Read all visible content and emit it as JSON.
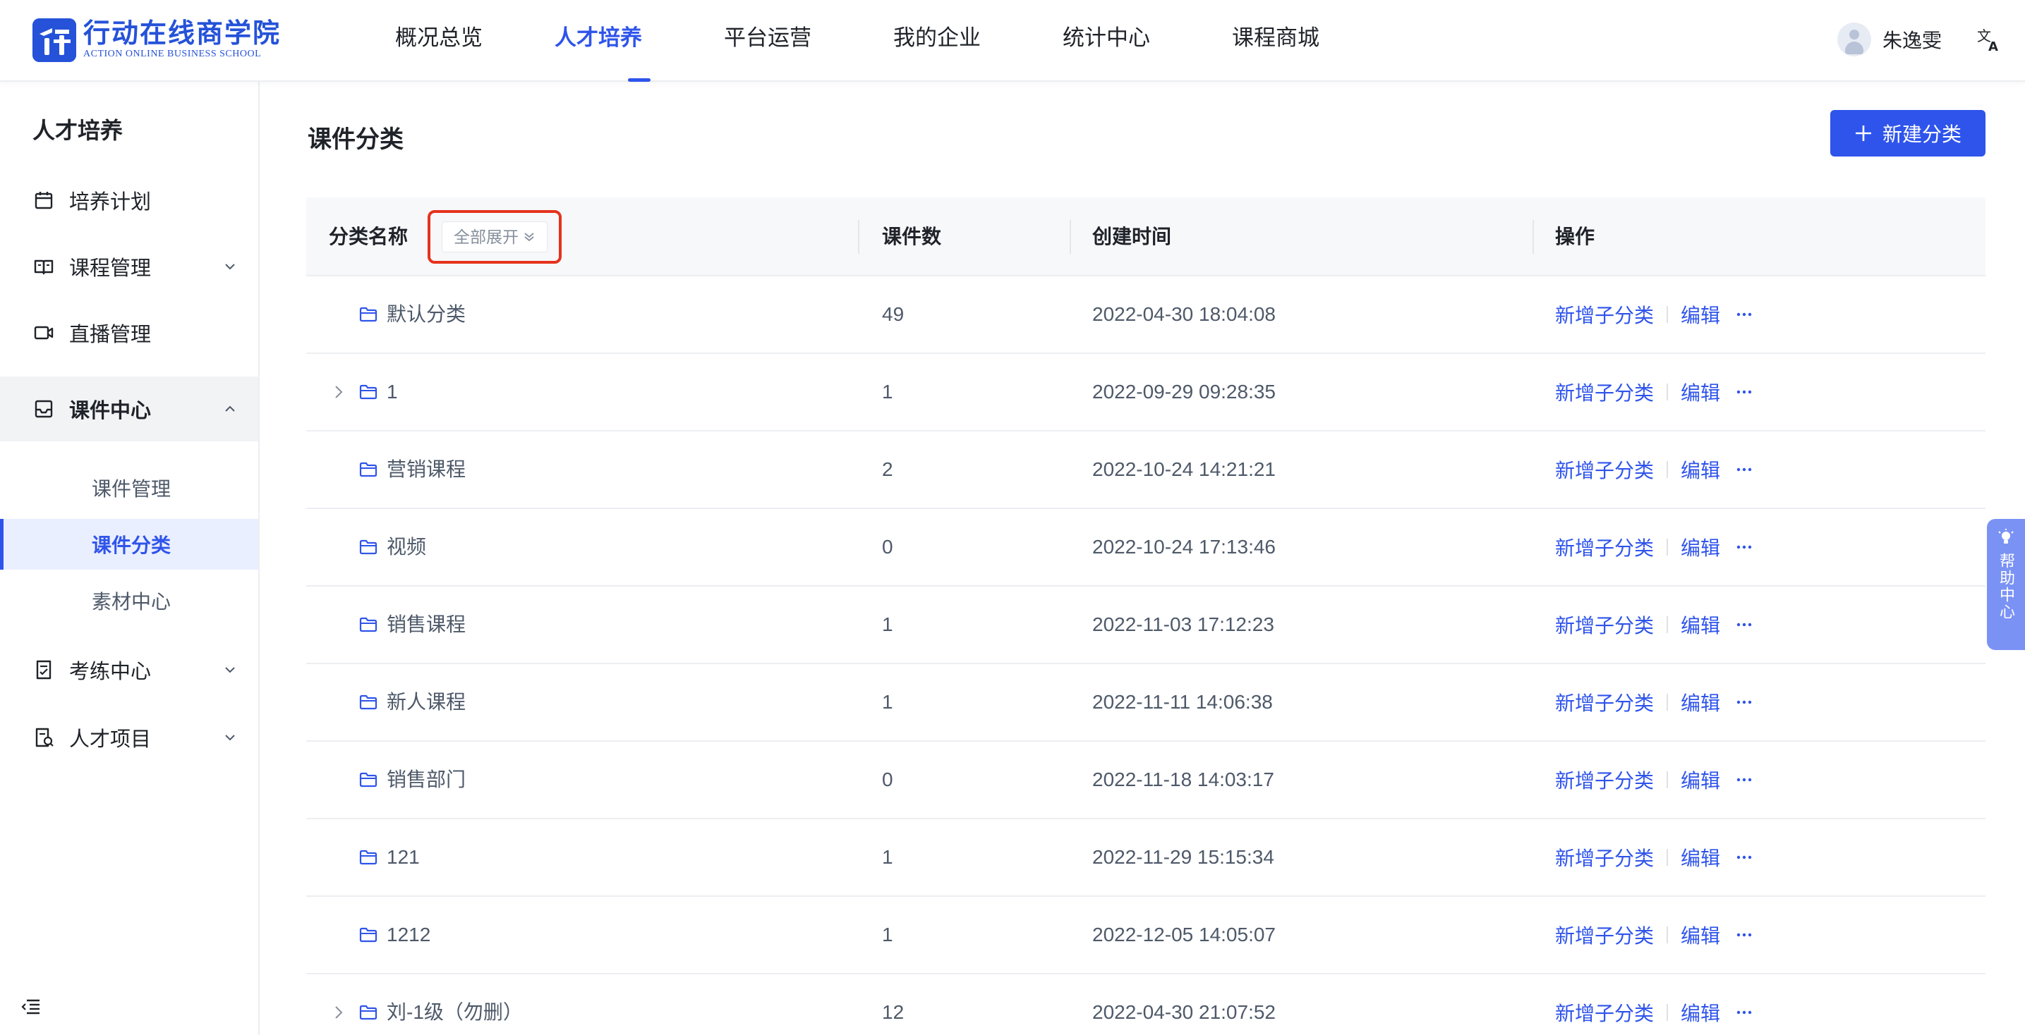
{
  "brand": {
    "name_cn": "行动在线商学院",
    "name_en": "ACTION ONLINE BUSINESS SCHOOL",
    "color": "#2552d9"
  },
  "nav": {
    "items": [
      {
        "label": "概况总览",
        "active": false
      },
      {
        "label": "人才培养",
        "active": true
      },
      {
        "label": "平台运营",
        "active": false
      },
      {
        "label": "我的企业",
        "active": false
      },
      {
        "label": "统计中心",
        "active": false
      },
      {
        "label": "课程商城",
        "active": false
      }
    ]
  },
  "user": {
    "name": "朱逸雯",
    "avatar_icon": "user-avatar-icon"
  },
  "sidebar": {
    "title": "人才培养",
    "items": [
      {
        "label": "培养计划",
        "icon": "calendar-icon"
      },
      {
        "label": "课程管理",
        "icon": "book-icon",
        "expandable": true
      },
      {
        "label": "直播管理",
        "icon": "video-icon"
      },
      {
        "label": "课件中心",
        "icon": "inbox-icon",
        "expandable": true,
        "open": true
      },
      {
        "label": "考练中心",
        "icon": "exam-icon",
        "expandable": true
      },
      {
        "label": "人才项目",
        "icon": "project-icon",
        "expandable": true
      }
    ],
    "subitems": [
      {
        "label": "课件管理",
        "active": false
      },
      {
        "label": "课件分类",
        "active": true
      },
      {
        "label": "素材中心",
        "active": false
      }
    ]
  },
  "page": {
    "title": "课件分类",
    "new_button": "新建分类",
    "accent": "#2f54eb"
  },
  "table": {
    "headers": {
      "name": "分类名称",
      "count": "课件数",
      "created": "创建时间",
      "actions": "操作"
    },
    "expand_all": "全部展开",
    "action_labels": {
      "add_child": "新增子分类",
      "edit": "编辑"
    },
    "rows": [
      {
        "name": "默认分类",
        "count": "49",
        "created": "2022-04-30 18:04:08",
        "has_children": false
      },
      {
        "name": "1",
        "count": "1",
        "created": "2022-09-29 09:28:35",
        "has_children": true
      },
      {
        "name": "营销课程",
        "count": "2",
        "created": "2022-10-24 14:21:21",
        "has_children": false
      },
      {
        "name": "视频",
        "count": "0",
        "created": "2022-10-24 17:13:46",
        "has_children": false
      },
      {
        "name": "销售课程",
        "count": "1",
        "created": "2022-11-03 17:12:23",
        "has_children": false
      },
      {
        "name": "新人课程",
        "count": "1",
        "created": "2022-11-11 14:06:38",
        "has_children": false
      },
      {
        "name": "销售部门",
        "count": "0",
        "created": "2022-11-18 14:03:17",
        "has_children": false
      },
      {
        "name": "121",
        "count": "1",
        "created": "2022-11-29 15:15:34",
        "has_children": false
      },
      {
        "name": "1212",
        "count": "1",
        "created": "2022-12-05 14:05:07",
        "has_children": false
      },
      {
        "name": "刘-1级（勿删）",
        "count": "12",
        "created": "2022-04-30 21:07:52",
        "has_children": true
      }
    ]
  },
  "help": {
    "label": "帮助中心",
    "color": "#7b92f5"
  }
}
